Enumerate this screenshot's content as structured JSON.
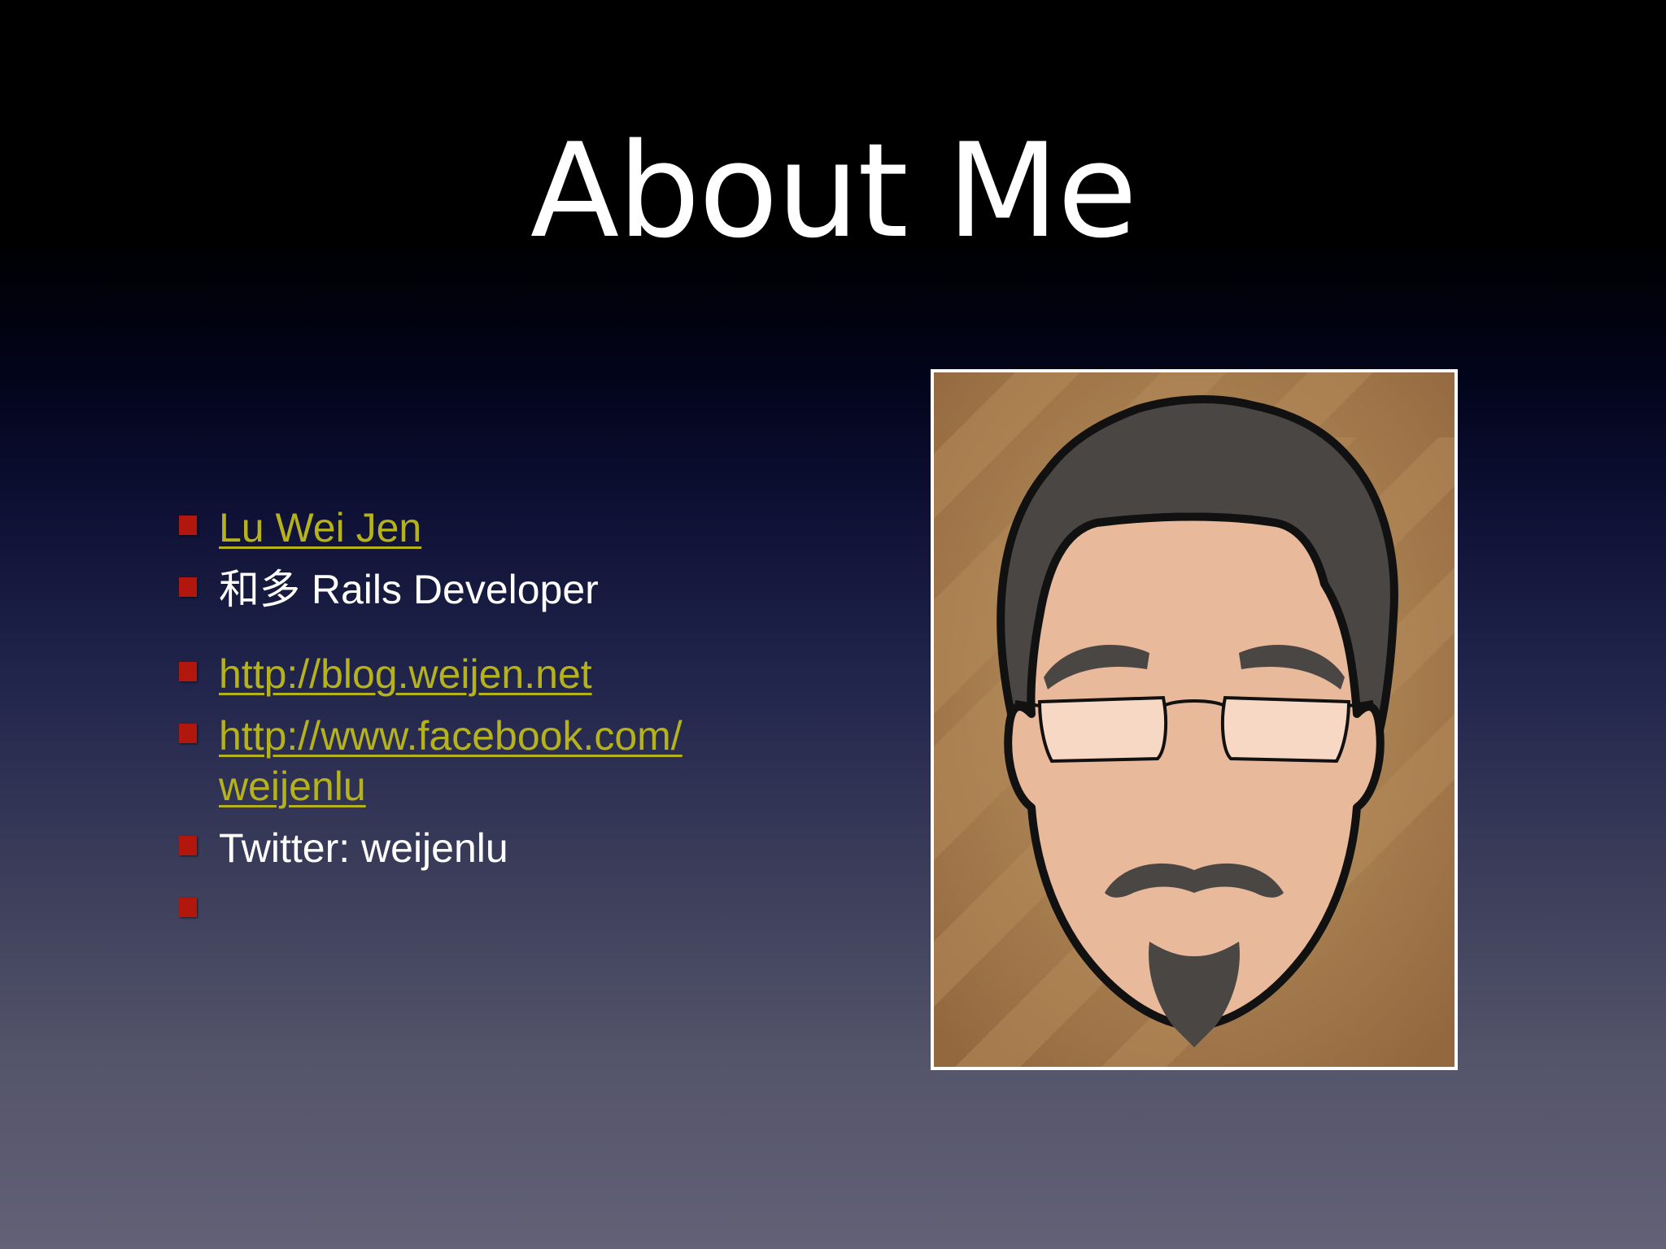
{
  "slide": {
    "title": "About Me"
  },
  "bullets": [
    {
      "text": "Lu Wei Jen",
      "link": true
    },
    {
      "text": "和多 Rails Developer",
      "link": false
    },
    {
      "text": "http://blog.weijen.net",
      "link": true
    },
    {
      "text": "http://www.facebook.com/\nweijenlu",
      "link": true
    },
    {
      "text": "Twitter: weijenlu",
      "link": false
    },
    {
      "text": "",
      "link": false
    }
  ],
  "colors": {
    "bullet_marker": "#b1170d",
    "link": "#b5b21c",
    "text": "#ffffff",
    "portrait_background": "#a3754a"
  },
  "portrait": {
    "icon": "cartoon-avatar-icon"
  }
}
